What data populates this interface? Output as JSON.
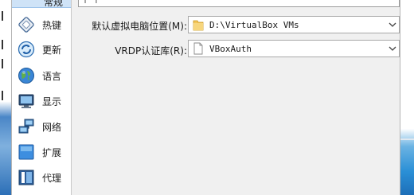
{
  "sidebar": {
    "partial_label": "常规",
    "items": [
      {
        "label": "热键",
        "icon": "hotkey-icon"
      },
      {
        "label": "更新",
        "icon": "update-icon"
      },
      {
        "label": "语言",
        "icon": "language-globe-icon"
      },
      {
        "label": "显示",
        "icon": "display-monitor-icon"
      },
      {
        "label": "网络",
        "icon": "network-icon"
      },
      {
        "label": "扩展",
        "icon": "extension-icon"
      },
      {
        "label": "代理",
        "icon": "proxy-icon"
      }
    ]
  },
  "settings": {
    "top_field_fragment": "↑ ↑",
    "default_machine_folder": {
      "label": "默认虚拟电脑位置(M):",
      "value": "D:\\VirtualBox VMs",
      "icon": "folder-icon"
    },
    "vrdp_auth_library": {
      "label": "VRDP认证库(R):",
      "value": "VBoxAuth",
      "icon": "file-icon"
    }
  },
  "colors": {
    "selection": "#cfe3f7",
    "dialog_bg": "#f0f0f0",
    "folder": "#f3c55a",
    "desktop_blue": "#2a8fd6"
  }
}
